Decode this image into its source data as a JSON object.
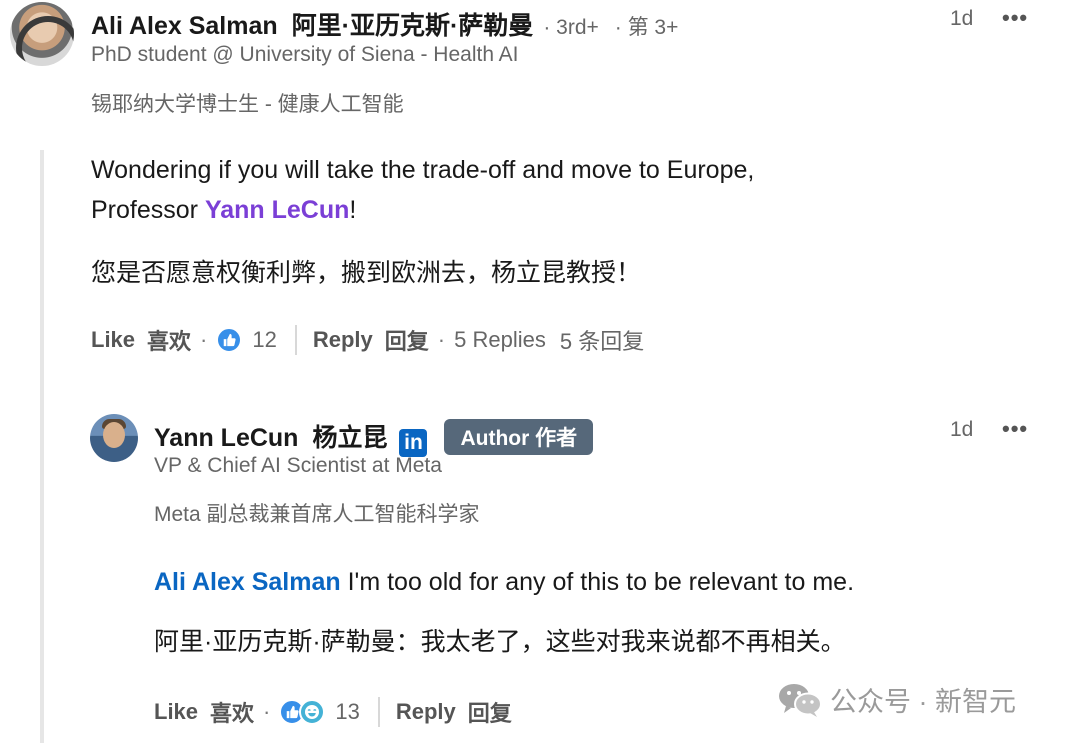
{
  "comment": {
    "name": "Ali Alex Salman",
    "name_cn": "阿里·亚历克斯·萨勒曼",
    "degree": "· 3rd+",
    "degree_cn": "· 第 3+",
    "headline": "PhD student @ University of Siena - Health AI",
    "headline_cn": "锡耶纳大学博士生 - 健康人工智能",
    "time": "1d",
    "more_label": "•••",
    "text_before_mention": "Wondering if you will take the trade-off and move to Europe,",
    "text_line2_prefix": "Professor ",
    "mention": "Yann LeCun",
    "text_after_mention": "!",
    "text_cn": "您是否愿意权衡利弊，搬到欧洲去，杨立昆教授！",
    "actions": {
      "like": "Like",
      "like_cn": "喜欢",
      "dot": "·",
      "reaction_count": "12",
      "reply": "Reply",
      "reply_cn": "回复",
      "replies": "5 Replies",
      "replies_cn": "5 条回复"
    }
  },
  "reply": {
    "name": "Yann LeCun",
    "name_cn": "杨立昆",
    "linkedin_badge": "in",
    "author_badge": "Author  作者",
    "headline": "VP & Chief AI Scientist at Meta",
    "headline_cn": "Meta 副总裁兼首席人工智能科学家",
    "time": "1d",
    "more_label": "•••",
    "mention": "Ali Alex Salman",
    "text": " I'm too old for any of this to be relevant to me.",
    "text_cn": "阿里·亚历克斯·萨勒曼：我太老了，这些对我来说都不再相关。",
    "actions": {
      "like": "Like",
      "like_cn": "喜欢",
      "dot": "·",
      "reaction_count": "13",
      "reply": "Reply",
      "reply_cn": "回复"
    }
  },
  "watermark": {
    "text": "公众号 · 新智元",
    "icon": "wechat-icon"
  },
  "colors": {
    "mention_purple": "#7b3fd6",
    "mention_blue": "#0a66c2",
    "like_blue": "#378fe9",
    "author_badge_bg": "#56687a"
  }
}
